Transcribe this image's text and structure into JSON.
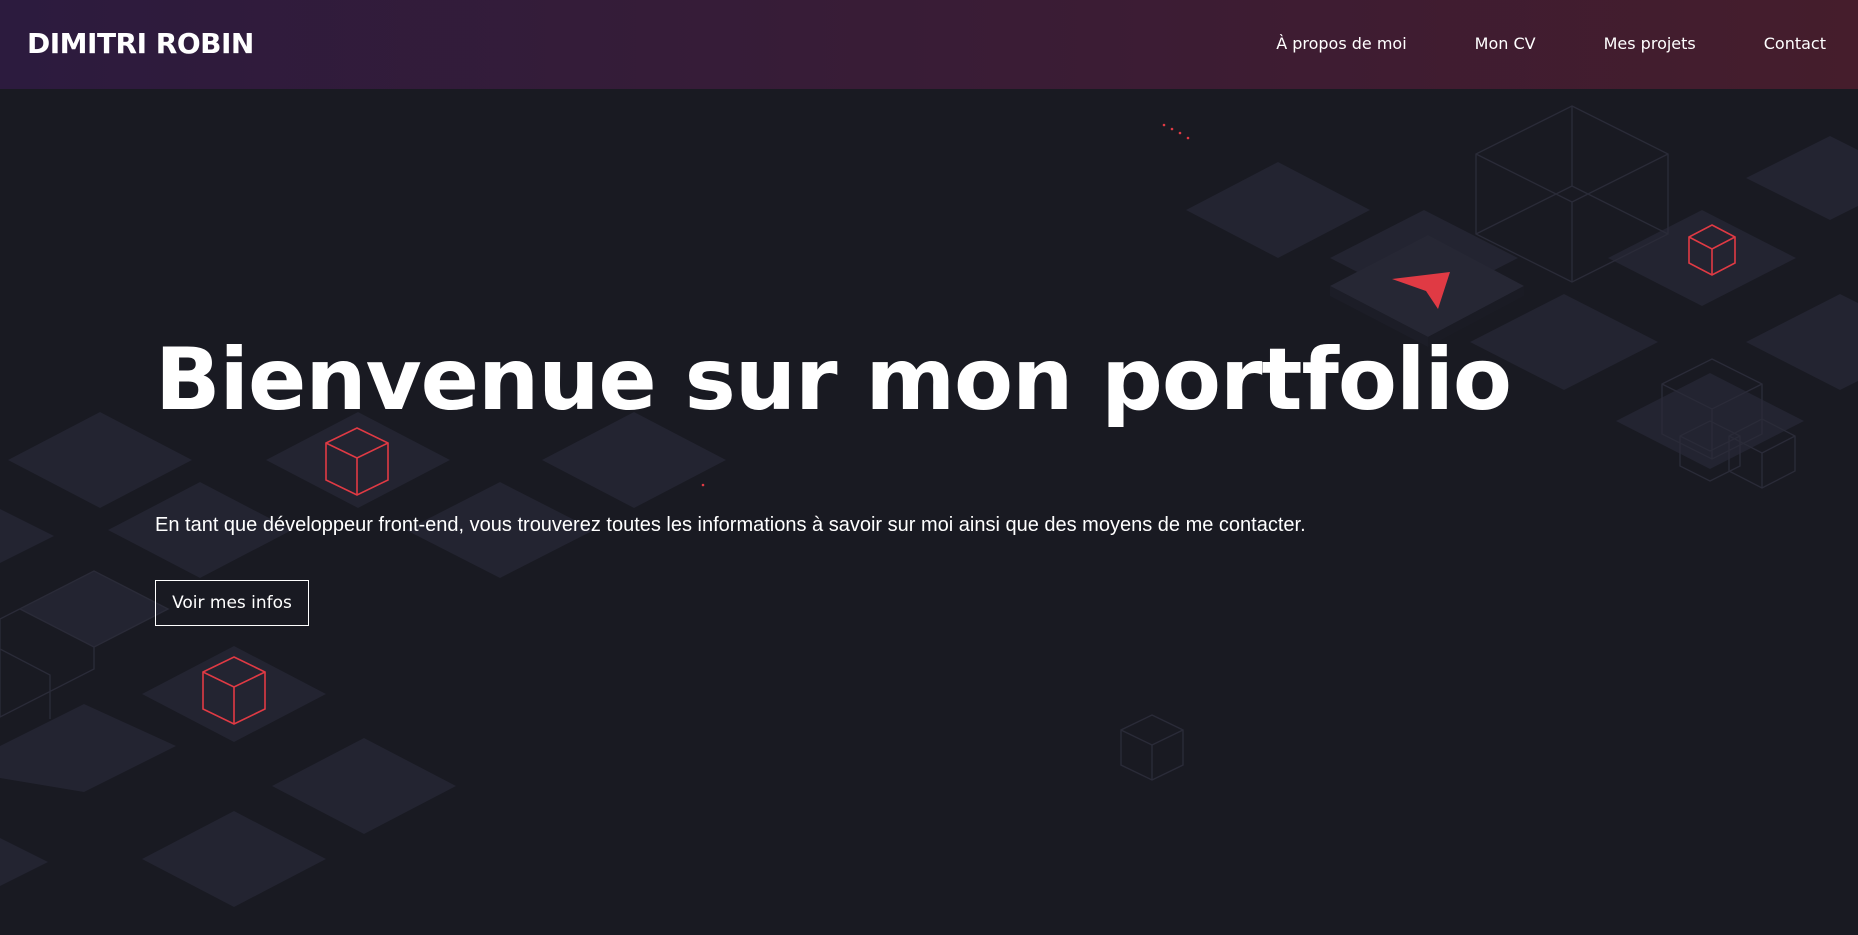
{
  "header": {
    "brand": "DIMITRI ROBIN",
    "nav": [
      {
        "label": "À propos de moi"
      },
      {
        "label": "Mon CV"
      },
      {
        "label": "Mes projets"
      },
      {
        "label": "Contact"
      }
    ]
  },
  "hero": {
    "title": "Bienvenue sur mon portfolio",
    "subtitle": "En tant que développeur front-end, vous trouverez toutes les informations à savoir sur moi ainsi que des moyens de me contacter.",
    "button_label": "Voir mes infos"
  },
  "colors": {
    "background": "#191a22",
    "tile": "#232431",
    "accent": "#e03a44",
    "header_gradient_start": "#2c1b3e",
    "header_gradient_end": "#451d2c",
    "text": "#ffffff"
  }
}
